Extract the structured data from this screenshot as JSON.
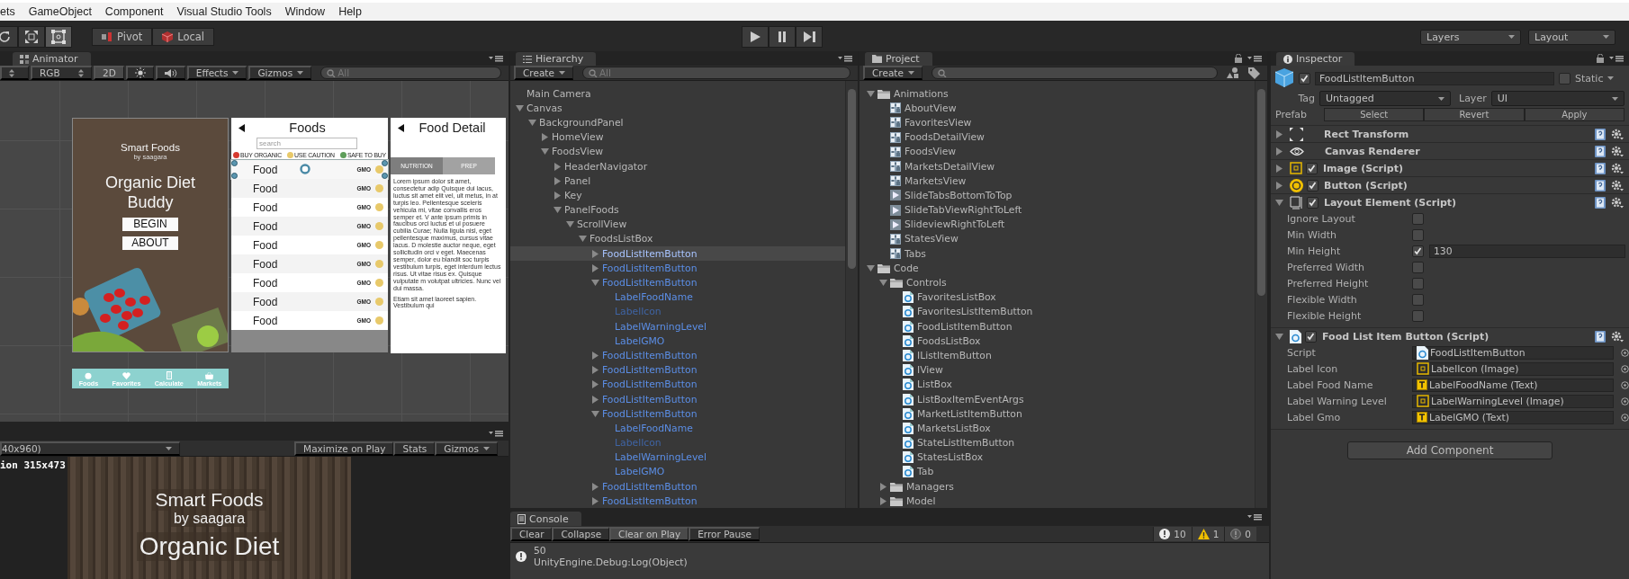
{
  "menu": [
    "ets",
    "GameObject",
    "Component",
    "Visual Studio Tools",
    "Window",
    "Help"
  ],
  "toolbar": {
    "tools": [
      {
        "kind": "rotate",
        "selected": false
      },
      {
        "kind": "scale",
        "selected": false
      },
      {
        "kind": "rect",
        "selected": true
      }
    ],
    "pivot": "Pivot",
    "local": "Local",
    "playback": [
      {
        "kind": "play"
      },
      {
        "kind": "pause"
      },
      {
        "kind": "step"
      }
    ],
    "layers": "Layers",
    "layout": "Layout"
  },
  "scene": {
    "tab": "Animator",
    "shading": "RGB",
    "mode_2d": {
      "label": "2D",
      "selected": true
    },
    "lighting": {
      "on": false
    },
    "audio": {
      "on": false
    },
    "effects": "Effects",
    "gizmos": "Gizmos",
    "search": {
      "placeholder": "All"
    },
    "home_screen": {
      "title": "Smart Foods",
      "subtitle": "by saagara",
      "headline": "Organic Diet Buddy",
      "buttons": [
        "BEGIN",
        "ABOUT"
      ]
    },
    "foods_screen": {
      "title": "Foods",
      "search": {
        "placeholder": "search"
      },
      "legend": [
        {
          "label": "BUY ORGANIC",
          "color": "#d63a2f"
        },
        {
          "label": "USE CAUTION",
          "color": "#e8c96a"
        },
        {
          "label": "SAFE TO BUY",
          "color": "#5e9e5a"
        }
      ],
      "rows": [
        {
          "name": "Food",
          "tag": "GMO",
          "color": "#e8c96a",
          "selected": true
        },
        {
          "name": "Food",
          "tag": "GMO",
          "color": "#e8c96a",
          "selected": false
        },
        {
          "name": "Food",
          "tag": "GMO",
          "color": "#e8c96a",
          "selected": false
        },
        {
          "name": "Food",
          "tag": "GMO",
          "color": "#e8c96a",
          "selected": false
        },
        {
          "name": "Food",
          "tag": "GMO",
          "color": "#e8c96a",
          "selected": false
        },
        {
          "name": "Food",
          "tag": "GMO",
          "color": "#e8c96a",
          "selected": false
        },
        {
          "name": "Food",
          "tag": "GMO",
          "color": "#e8c96a",
          "selected": false
        },
        {
          "name": "Food",
          "tag": "GMO",
          "color": "#e8c96a",
          "selected": false
        },
        {
          "name": "Food",
          "tag": "GMO",
          "color": "#e8c96a",
          "selected": false
        }
      ]
    },
    "detail_screen": {
      "title": "Food Detail",
      "tabs": [
        {
          "label": "NUTRITION",
          "selected": true
        },
        {
          "label": "PREP",
          "selected": false
        }
      ],
      "body": "Lorem ipsum dolor sit amet, consectetur adip Quisque dui lacus, luctus sit amet elit vel, ult metus, in at turpis leo. Pellentesque sceleris vehicula mi, vitae convallis eros semper et. V ante ipsum primis in faucibus orci luctus et ul posuere cubilia Curae; Nulla ligula nisl, eget pellentesque maximus, cursus vitae lacus. D molestie auctor neque, eget sollicitudin orci v eget. Maecenas semper, dolor eu blandit soc turpis vestibulum turpis, eget interdum lectus risus. Ut vitae risus ex. Quisque vulputate m volutpat ultricies. Nunc vel dui massa.",
      "footer": "Etiam sit amet laoreet sapien. Vestibulum qui"
    },
    "tab_bar": [
      {
        "kind": "foods",
        "label": "Foods"
      },
      {
        "kind": "favorites",
        "label": "Favorites"
      },
      {
        "kind": "calculate",
        "label": "Calculate"
      },
      {
        "kind": "markets",
        "label": "Markets"
      }
    ]
  },
  "game": {
    "resolution_menu": "40x960)",
    "buttons": [
      {
        "label": "Maximize on Play",
        "dropdown": false
      },
      {
        "label": "Stats",
        "dropdown": false
      },
      {
        "label": "Gizmos",
        "dropdown": true
      }
    ],
    "resolution": "ion 315x473",
    "title": "Smart Foods",
    "subtitle": "by saagara",
    "headline": "Organic Diet"
  },
  "hierarchy": {
    "tab": "Hierarchy",
    "create": "Create",
    "search": {
      "placeholder": "All"
    },
    "tree": [
      {
        "name": "Main Camera",
        "selected": false
      },
      {
        "name": "Canvas",
        "expanded": true,
        "selected": false,
        "children": [
          {
            "name": "BackgroundPanel",
            "expanded": true,
            "selected": false,
            "children": [
              {
                "name": "HomeView",
                "expanded": false,
                "selected": false
              },
              {
                "name": "FoodsView",
                "expanded": true,
                "selected": false,
                "children": [
                  {
                    "name": "HeaderNavigator",
                    "expanded": false,
                    "selected": false
                  },
                  {
                    "name": "Panel",
                    "expanded": false,
                    "selected": false
                  },
                  {
                    "name": "Key",
                    "expanded": false,
                    "selected": false
                  },
                  {
                    "name": "PanelFoods",
                    "expanded": true,
                    "selected": false,
                    "children": [
                      {
                        "name": "ScrollView",
                        "expanded": true,
                        "selected": false,
                        "children": [
                          {
                            "name": "FoodsListBox",
                            "expanded": true,
                            "selected": false,
                            "children": [
                              {
                                "name": "FoodListItemButton",
                                "prefab": true,
                                "expanded": false,
                                "selected": true
                              },
                              {
                                "name": "FoodListItemButton",
                                "prefab": true,
                                "expanded": false,
                                "selected": false
                              },
                              {
                                "name": "FoodListItemButton",
                                "prefab": true,
                                "expanded": true,
                                "selected": false,
                                "children": [
                                  {
                                    "name": "LabelFoodName",
                                    "prefab": true,
                                    "inactive": false,
                                    "selected": false
                                  },
                                  {
                                    "name": "LabelIcon",
                                    "prefab": true,
                                    "inactive": true,
                                    "selected": false
                                  },
                                  {
                                    "name": "LabelWarningLevel",
                                    "prefab": true,
                                    "inactive": false,
                                    "selected": false
                                  },
                                  {
                                    "name": "LabelGMO",
                                    "prefab": true,
                                    "inactive": false,
                                    "selected": false
                                  }
                                ]
                              },
                              {
                                "name": "FoodListItemButton",
                                "prefab": true,
                                "expanded": false,
                                "selected": false
                              },
                              {
                                "name": "FoodListItemButton",
                                "prefab": true,
                                "expanded": false,
                                "selected": false
                              },
                              {
                                "name": "FoodListItemButton",
                                "prefab": true,
                                "expanded": false,
                                "selected": false
                              },
                              {
                                "name": "FoodListItemButton",
                                "prefab": true,
                                "expanded": false,
                                "selected": false
                              },
                              {
                                "name": "FoodListItemButton",
                                "prefab": true,
                                "expanded": true,
                                "selected": false,
                                "children": [
                                  {
                                    "name": "LabelFoodName",
                                    "prefab": true,
                                    "inactive": false,
                                    "selected": false
                                  },
                                  {
                                    "name": "LabelIcon",
                                    "prefab": true,
                                    "inactive": true,
                                    "selected": false
                                  },
                                  {
                                    "name": "LabelWarningLevel",
                                    "prefab": true,
                                    "inactive": false,
                                    "selected": false
                                  },
                                  {
                                    "name": "LabelGMO",
                                    "prefab": true,
                                    "inactive": false,
                                    "selected": false
                                  }
                                ]
                              },
                              {
                                "name": "FoodListItemButton",
                                "prefab": true,
                                "expanded": false,
                                "selected": false
                              },
                              {
                                "name": "FoodListItemButton",
                                "prefab": true,
                                "expanded": false,
                                "selected": false
                              }
                            ]
                          }
                        ]
                      }
                    ]
                  }
                ]
              }
            ]
          }
        ]
      }
    ]
  },
  "project": {
    "tab": "Project",
    "create": "Create",
    "tree": [
      {
        "name": "Animations",
        "kind": "folder",
        "expanded": true,
        "children": [
          {
            "name": "AboutView",
            "kind": "controller"
          },
          {
            "name": "FavoritesView",
            "kind": "controller"
          },
          {
            "name": "FoodsDetailView",
            "kind": "controller"
          },
          {
            "name": "FoodsView",
            "kind": "controller"
          },
          {
            "name": "MarketsDetailView",
            "kind": "controller"
          },
          {
            "name": "MarketsView",
            "kind": "controller"
          },
          {
            "name": "SlideTabsBottomToTop",
            "kind": "clip"
          },
          {
            "name": "SlideTabViewRightToLeft",
            "kind": "clip"
          },
          {
            "name": "SlideviewRightToLeft",
            "kind": "clip"
          },
          {
            "name": "StatesView",
            "kind": "controller"
          },
          {
            "name": "Tabs",
            "kind": "controller"
          }
        ]
      },
      {
        "name": "Code",
        "kind": "folder",
        "expanded": true,
        "children": [
          {
            "name": "Controls",
            "kind": "folder",
            "expanded": true,
            "children": [
              {
                "name": "FavoritesListBox",
                "kind": "script"
              },
              {
                "name": "FavoritesListItemButton",
                "kind": "script"
              },
              {
                "name": "FoodListItemButton",
                "kind": "script"
              },
              {
                "name": "FoodsListBox",
                "kind": "script"
              },
              {
                "name": "IListItemButton",
                "kind": "script"
              },
              {
                "name": "IView",
                "kind": "script"
              },
              {
                "name": "ListBox",
                "kind": "script"
              },
              {
                "name": "ListBoxItemEventArgs",
                "kind": "script"
              },
              {
                "name": "MarketListItemButton",
                "kind": "script"
              },
              {
                "name": "MarketsListBox",
                "kind": "script"
              },
              {
                "name": "StateListItemButton",
                "kind": "script"
              },
              {
                "name": "StatesListBox",
                "kind": "script"
              },
              {
                "name": "Tab",
                "kind": "script"
              }
            ]
          },
          {
            "name": "Managers",
            "kind": "folder",
            "expanded": false
          },
          {
            "name": "Model",
            "kind": "folder",
            "expanded": false
          }
        ]
      }
    ]
  },
  "console": {
    "tab": "Console",
    "buttons": [
      {
        "label": "Clear",
        "selected": false
      },
      {
        "label": "Collapse",
        "selected": false
      },
      {
        "label": "Clear on Play",
        "selected": true
      },
      {
        "label": "Error Pause",
        "selected": false
      }
    ],
    "counters": [
      {
        "kind": "info",
        "count": "10"
      },
      {
        "kind": "warning",
        "count": "1"
      },
      {
        "kind": "error",
        "count": "0"
      }
    ],
    "entries": [
      {
        "kind": "info",
        "message": "50",
        "detail": "UnityEngine.Debug:Log(Object)"
      }
    ]
  },
  "inspector": {
    "tab": "Inspector",
    "object": {
      "active": true,
      "name": "FoodListItemButton",
      "static_label": "Static",
      "static": false
    },
    "tag_label": "Tag",
    "tag": "Untagged",
    "layer_label": "Layer",
    "layer": "UI",
    "prefab_label": "Prefab",
    "prefab_buttons": [
      "Select",
      "Revert",
      "Apply"
    ],
    "components": [
      {
        "name": "Rect Transform",
        "kind": "rect_transform",
        "expanded": false
      },
      {
        "name": "Canvas Renderer",
        "kind": "eye",
        "expanded": false
      },
      {
        "name": "Image (Script)",
        "kind": "image",
        "enabled": true,
        "expanded": false
      },
      {
        "name": "Button (Script)",
        "kind": "ok",
        "enabled": true,
        "expanded": false
      },
      {
        "name": "Layout Element (Script)",
        "kind": "layout",
        "enabled": true,
        "expanded": true,
        "fields": [
          {
            "kind": "toggle",
            "label": "Ignore Layout",
            "checked": false
          },
          {
            "kind": "toggle",
            "label": "Min Width",
            "checked": false
          },
          {
            "kind": "toggle",
            "label": "Min Height",
            "checked": true,
            "value": "130"
          },
          {
            "kind": "toggle",
            "label": "Preferred Width",
            "checked": false
          },
          {
            "kind": "toggle",
            "label": "Preferred Height",
            "checked": false
          },
          {
            "kind": "toggle",
            "label": "Flexible Width",
            "checked": false
          },
          {
            "kind": "toggle",
            "label": "Flexible Height",
            "checked": false
          }
        ]
      },
      {
        "name": "Food List Item Button (Script)",
        "kind": "script",
        "enabled": true,
        "expanded": true,
        "fields": [
          {
            "kind": "script_reference",
            "label": "Script",
            "value": "FoodListItemButton"
          },
          {
            "kind": "image_reference",
            "label": "Label Icon",
            "value": "LabelIcon (Image)"
          },
          {
            "kind": "text_reference",
            "label": "Label Food Name",
            "value": "LabelFoodName (Text)"
          },
          {
            "kind": "image_reference",
            "label": "Label Warning Level",
            "value": "LabelWarningLevel (Image)"
          },
          {
            "kind": "text_reference",
            "label": "Label Gmo",
            "value": "LabelGMO (Text)"
          }
        ]
      }
    ],
    "add_component": "Add Component"
  }
}
